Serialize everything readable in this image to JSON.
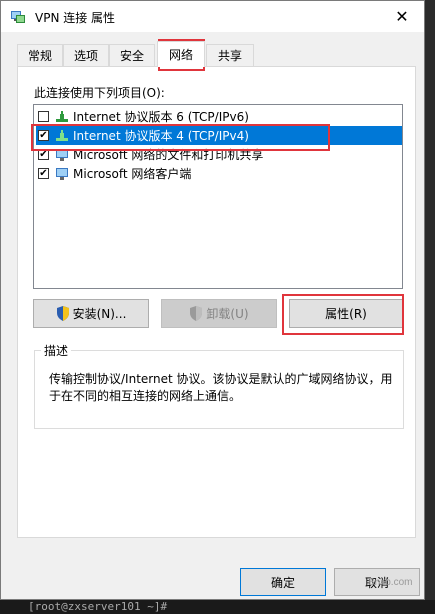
{
  "window": {
    "title": "VPN 连接 属性",
    "close": "✕"
  },
  "tabs": [
    {
      "label": "常规"
    },
    {
      "label": "选项"
    },
    {
      "label": "安全"
    },
    {
      "label": "网络",
      "active": true
    },
    {
      "label": "共享"
    }
  ],
  "network": {
    "connection_label": "此连接使用下列项目(O):",
    "items": [
      {
        "label": "Internet 协议版本 6 (TCP/IPv6)",
        "checked": false,
        "icon": "network-protocol-icon"
      },
      {
        "label": "Internet 协议版本 4 (TCP/IPv4)",
        "checked": true,
        "selected": true,
        "icon": "network-protocol-icon"
      },
      {
        "label": "Microsoft 网络的文件和打印机共享",
        "checked": true,
        "icon": "network-service-icon"
      },
      {
        "label": "Microsoft 网络客户端",
        "checked": true,
        "icon": "network-client-icon"
      }
    ],
    "buttons": {
      "install": "安装(N)...",
      "uninstall": "卸载(U)",
      "properties": "属性(R)"
    },
    "description": {
      "title": "描述",
      "text": "传输控制协议/Internet 协议。该协议是默认的广域网络协议，用于在不同的相互连接的网络上通信。"
    }
  },
  "footer": {
    "ok": "确定",
    "cancel": "取消"
  },
  "background": {
    "terminal_text": "[root@zxserver101 ~]#",
    "watermark": "Bnxb.com"
  },
  "colors": {
    "selection": "#0078d7",
    "highlight": "#e0353c",
    "accent": "#0078d7"
  }
}
